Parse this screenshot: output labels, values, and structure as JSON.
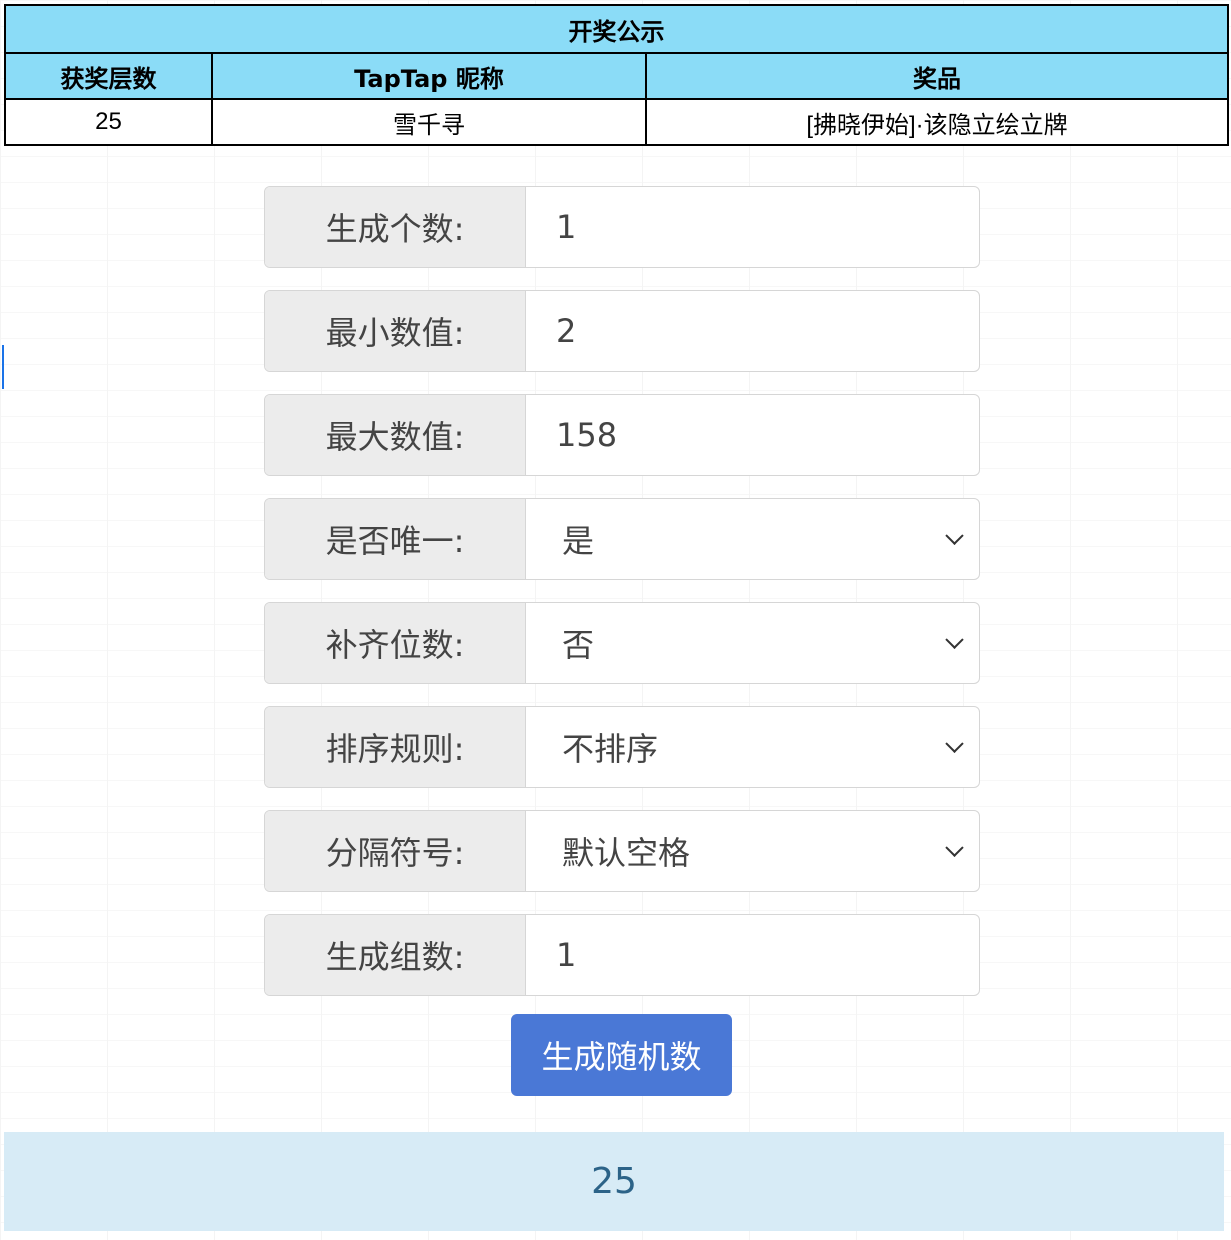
{
  "table": {
    "title": "开奖公示",
    "headers": [
      "获奖层数",
      "TapTap 昵称",
      "奖品"
    ],
    "row": [
      "25",
      "雪千寻",
      "[拂晓伊始]·该隐立绘立牌"
    ]
  },
  "form": {
    "count": {
      "label": "生成个数:",
      "value": "1"
    },
    "min": {
      "label": "最小数值:",
      "value": "2"
    },
    "max": {
      "label": "最大数值:",
      "value": "158"
    },
    "unique": {
      "label": "是否唯一:",
      "value": "是"
    },
    "pad": {
      "label": "补齐位数:",
      "value": "否"
    },
    "sort": {
      "label": "排序规则:",
      "value": "不排序"
    },
    "separator": {
      "label": "分隔符号:",
      "value": "默认空格"
    },
    "groups": {
      "label": "生成组数:",
      "value": "1"
    }
  },
  "button": {
    "label": "生成随机数"
  },
  "result": {
    "value": "25"
  },
  "colors": {
    "table_header_bg": "#8bdcf7",
    "button_bg": "#4a78d6",
    "result_bg": "#d7ebf6",
    "result_text": "#2c6388"
  }
}
